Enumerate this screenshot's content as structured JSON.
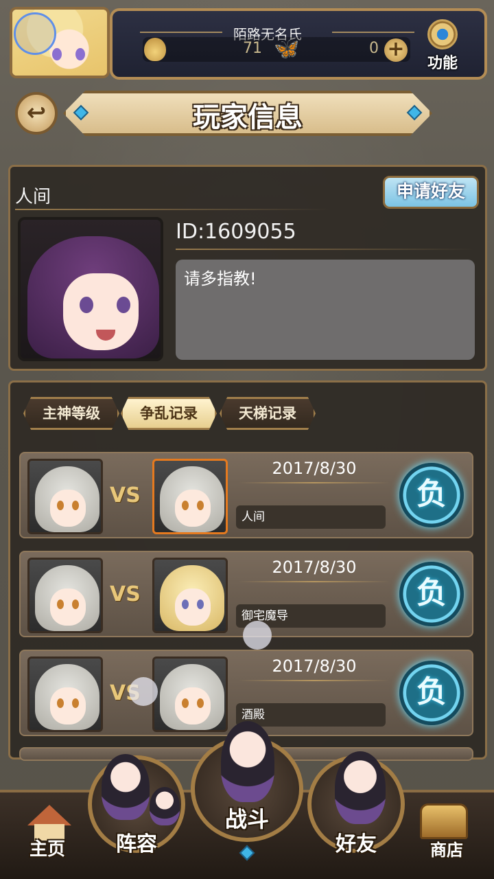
{
  "header": {
    "player_name": "陌路无名氏",
    "coin_value": "71",
    "gem_value": "0",
    "function_label": "功能"
  },
  "title": {
    "text": "玩家信息"
  },
  "profile": {
    "nickname": "人间",
    "add_friend_label": "申请好友",
    "id_text": "ID:1609055",
    "signature": "请多指教!"
  },
  "tabs": [
    {
      "label": "主神等级",
      "active": false
    },
    {
      "label": "争乱记录",
      "active": true
    },
    {
      "label": "天梯记录",
      "active": false
    }
  ],
  "records": [
    {
      "vs": "VS",
      "date": "2017/8/30",
      "opponent": "人间",
      "result": "负"
    },
    {
      "vs": "VS",
      "date": "2017/8/30",
      "opponent": "御宅魔导",
      "result": "负"
    },
    {
      "vs": "VS",
      "date": "2017/8/30",
      "opponent": "酒殿",
      "result": "负"
    }
  ],
  "nav": {
    "home": "主页",
    "lineup": "阵容",
    "battle": "战斗",
    "friends": "好友",
    "shop": "商店"
  },
  "colors": {
    "panel_border": "#8b6f48",
    "accent_gold": "#e8c77a",
    "result_blue": "#73d4f0"
  },
  "icons": {
    "back": "back-arrow-icon",
    "function": "gear-icon",
    "coin": "flame-icon",
    "gem": "butterfly-icon",
    "plus": "plus-icon",
    "home": "house-icon",
    "shop": "treasure-chest-icon"
  }
}
